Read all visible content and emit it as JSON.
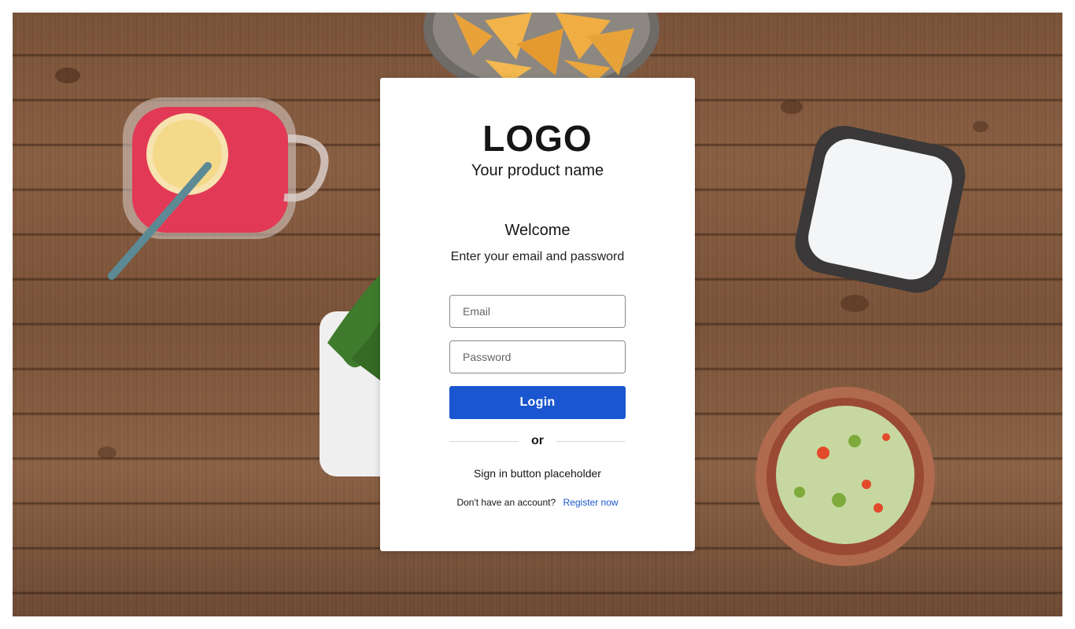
{
  "brand": {
    "logo_text": "LOGO",
    "product_name": "Your product name"
  },
  "login": {
    "heading": "Welcome",
    "instruction": "Enter your email and password",
    "email_placeholder": "Email",
    "password_placeholder": "Password",
    "submit_label": "Login",
    "divider_label": "or",
    "sso_placeholder": "Sign in button placeholder",
    "register_prompt": "Don't have an account?",
    "register_link": "Register now"
  },
  "colors": {
    "primary": "#1a56cf",
    "card_background": "#ffffff",
    "text": "#161616"
  },
  "background": {
    "description_icons": [
      "lemonade-jar-icon",
      "nachos-bowl-icon",
      "sour-cream-bowl-icon",
      "guacamole-bowl-icon",
      "herb-plate-icon"
    ]
  }
}
